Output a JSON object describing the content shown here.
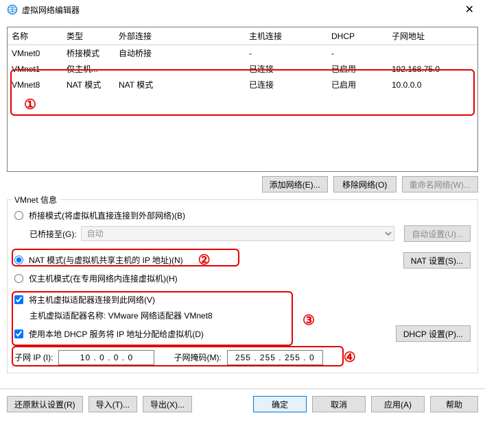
{
  "window": {
    "title": "虚拟网络编辑器",
    "close": "✕"
  },
  "table": {
    "headers": {
      "name": "名称",
      "type": "类型",
      "ext": "外部连接",
      "host": "主机连接",
      "dhcp": "DHCP",
      "subnet": "子网地址"
    },
    "rows": [
      {
        "name": "VMnet0",
        "type": "桥接模式",
        "ext": "自动桥接",
        "host": "-",
        "dhcp": "-",
        "subnet": ""
      },
      {
        "name": "VMnet1",
        "type": "仅主机...",
        "ext": "-",
        "host": "已连接",
        "dhcp": "已启用",
        "subnet": "192.168.75.0"
      },
      {
        "name": "VMnet8",
        "type": "NAT 模式",
        "ext": "NAT 模式",
        "host": "已连接",
        "dhcp": "已启用",
        "subnet": "10.0.0.0"
      }
    ]
  },
  "annot": {
    "c1": "①",
    "c2": "②",
    "c3": "③",
    "c4": "④"
  },
  "buttons": {
    "add": "添加网络(E)...",
    "remove": "移除网络(O)",
    "rename": "重命名网络(W)...",
    "autoset": "自动设置(U)...",
    "natset": "NAT 设置(S)...",
    "dhcpset": "DHCP 设置(P)...",
    "restore": "还原默认设置(R)",
    "import": "导入(T)...",
    "export": "导出(X)...",
    "ok": "确定",
    "cancel": "取消",
    "apply": "应用(A)",
    "help": "帮助"
  },
  "info": {
    "section": "VMnet 信息",
    "bridge_label": "桥接模式(将虚拟机直接连接到外部网络)(B)",
    "bridge_to": "已桥接至(G):",
    "bridge_combo": "自动",
    "nat_label": "NAT 模式(与虚拟机共享主机的 IP 地址)(N)",
    "hostonly_label": "仅主机模式(在专用网络内连接虚拟机)(H)",
    "connect_host": "将主机虚拟适配器连接到此网络(V)",
    "adapter_name": "主机虚拟适配器名称: VMware 网络适配器 VMnet8",
    "use_dhcp": "使用本地 DHCP 服务将 IP 地址分配给虚拟机(D)",
    "subnet_ip_label": "子网 IP (I):",
    "subnet_ip": "10 . 0 . 0 . 0",
    "subnet_mask_label": "子网掩码(M):",
    "subnet_mask": "255 . 255 . 255 . 0"
  }
}
